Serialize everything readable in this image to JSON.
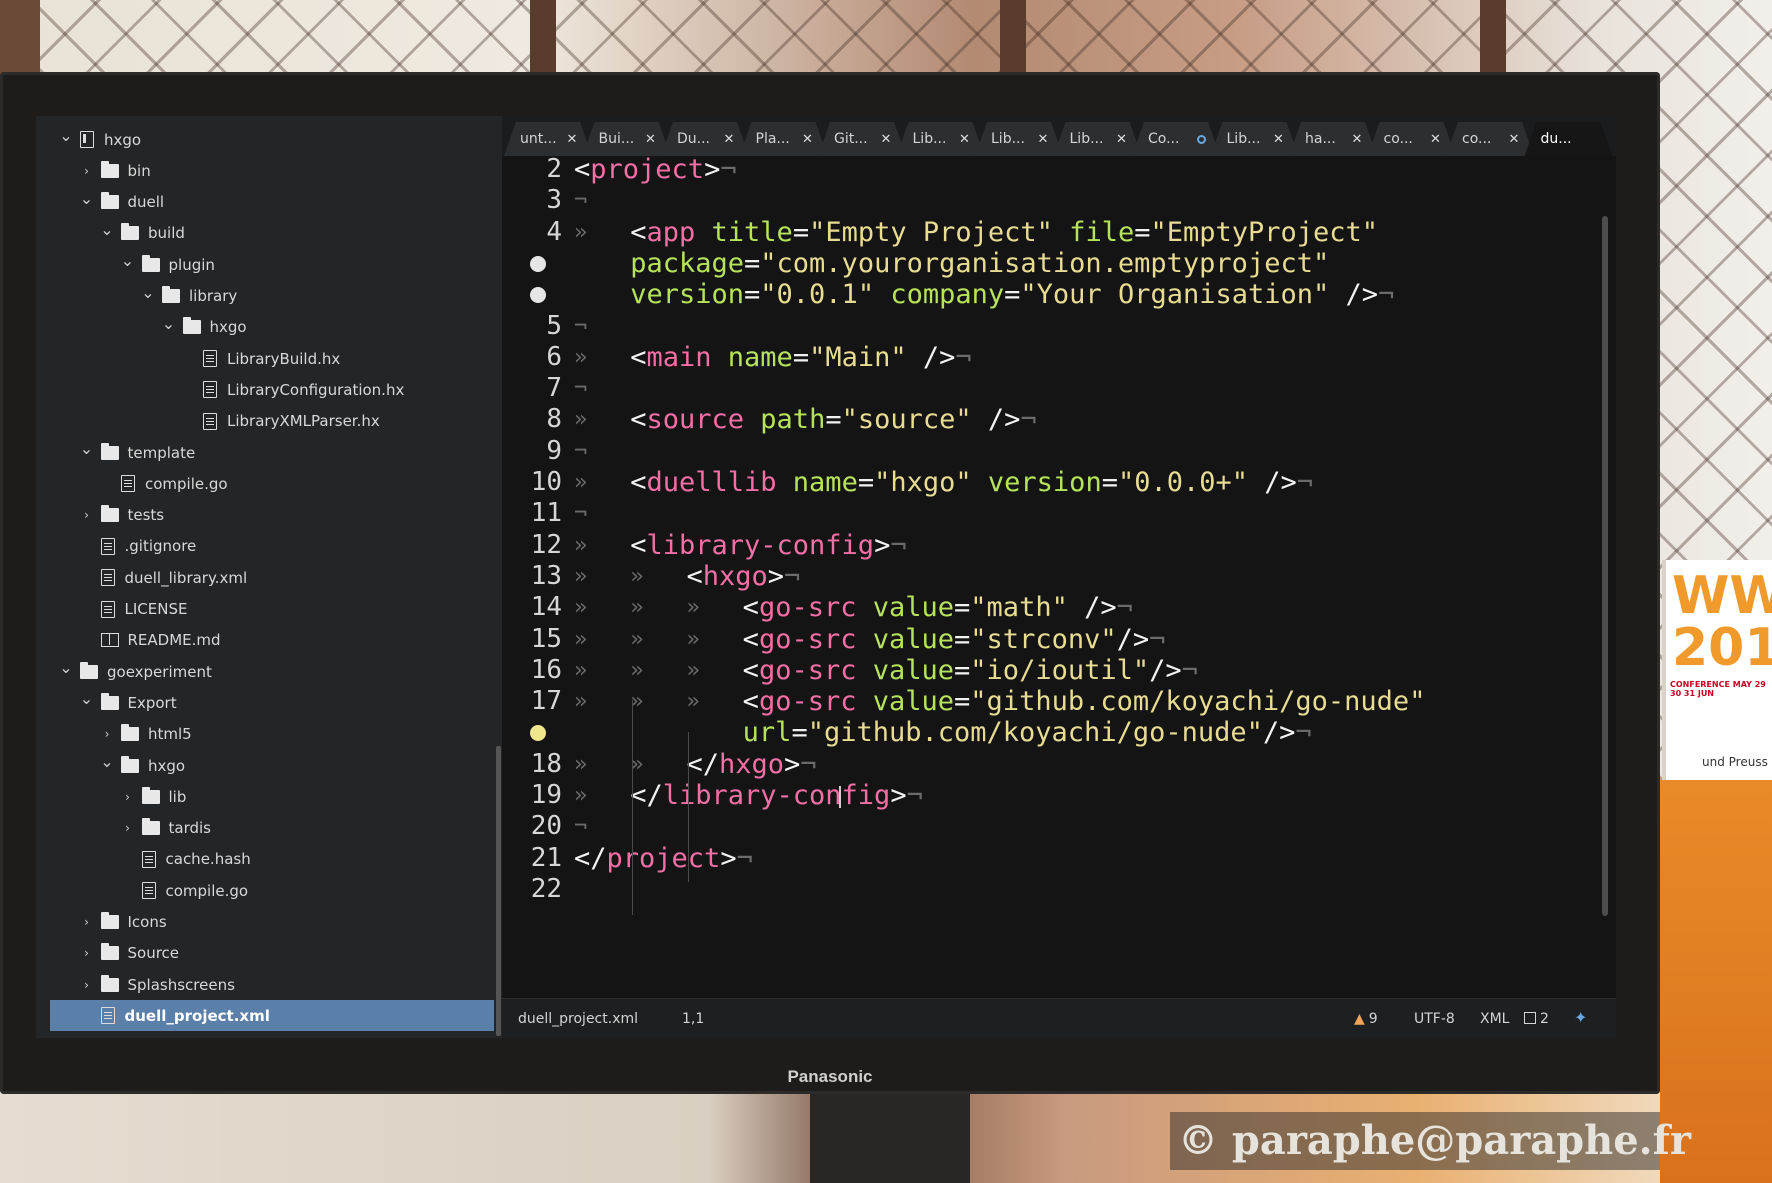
{
  "sidebar": {
    "tree": [
      {
        "label": "hxgo",
        "icon": "repo-icon",
        "chevron": "down",
        "depth": 0
      },
      {
        "label": "bin",
        "icon": "folder-icon",
        "chevron": "right",
        "depth": 1
      },
      {
        "label": "duell",
        "icon": "folder-icon",
        "chevron": "down",
        "depth": 1
      },
      {
        "label": "build",
        "icon": "folder-icon",
        "chevron": "down",
        "depth": 2
      },
      {
        "label": "plugin",
        "icon": "folder-icon",
        "chevron": "down",
        "depth": 3
      },
      {
        "label": "library",
        "icon": "folder-icon",
        "chevron": "down",
        "depth": 4
      },
      {
        "label": "hxgo",
        "icon": "folder-icon",
        "chevron": "down",
        "depth": 5
      },
      {
        "label": "LibraryBuild.hx",
        "icon": "file-icon",
        "chevron": "none",
        "depth": 6
      },
      {
        "label": "LibraryConfiguration.hx",
        "icon": "file-icon",
        "chevron": "none",
        "depth": 6
      },
      {
        "label": "LibraryXMLParser.hx",
        "icon": "file-icon",
        "chevron": "none",
        "depth": 6
      },
      {
        "label": "template",
        "icon": "folder-icon",
        "chevron": "down",
        "depth": 1
      },
      {
        "label": "compile.go",
        "icon": "file-icon",
        "chevron": "none",
        "depth": 2
      },
      {
        "label": "tests",
        "icon": "folder-icon",
        "chevron": "right",
        "depth": 1
      },
      {
        "label": ".gitignore",
        "icon": "file-icon",
        "chevron": "none",
        "depth": 1
      },
      {
        "label": "duell_library.xml",
        "icon": "file-icon",
        "chevron": "none",
        "depth": 1
      },
      {
        "label": "LICENSE",
        "icon": "file-icon",
        "chevron": "none",
        "depth": 1
      },
      {
        "label": "README.md",
        "icon": "book-icon",
        "chevron": "none",
        "depth": 1
      },
      {
        "label": "goexperiment",
        "icon": "folder-icon",
        "chevron": "down",
        "depth": 0
      },
      {
        "label": "Export",
        "icon": "folder-icon",
        "chevron": "down",
        "depth": 1
      },
      {
        "label": "html5",
        "icon": "folder-icon",
        "chevron": "right",
        "depth": 2
      },
      {
        "label": "hxgo",
        "icon": "folder-icon",
        "chevron": "down",
        "depth": 2
      },
      {
        "label": "lib",
        "icon": "folder-icon",
        "chevron": "right",
        "depth": 3
      },
      {
        "label": "tardis",
        "icon": "folder-icon",
        "chevron": "right",
        "depth": 3
      },
      {
        "label": "cache.hash",
        "icon": "file-icon",
        "chevron": "none",
        "depth": 3
      },
      {
        "label": "compile.go",
        "icon": "file-icon",
        "chevron": "none",
        "depth": 3
      },
      {
        "label": "Icons",
        "icon": "folder-icon",
        "chevron": "right",
        "depth": 1
      },
      {
        "label": "Source",
        "icon": "folder-icon",
        "chevron": "right",
        "depth": 1
      },
      {
        "label": "Splashscreens",
        "icon": "folder-icon",
        "chevron": "right",
        "depth": 1
      },
      {
        "label": "duell_project.xml",
        "icon": "file-icon",
        "chevron": "none",
        "depth": 1,
        "selected": true
      }
    ]
  },
  "tabs": [
    {
      "label": "unt...",
      "modified": false
    },
    {
      "label": "Bui...",
      "modified": false
    },
    {
      "label": "Du...",
      "modified": false
    },
    {
      "label": "Pla...",
      "modified": false
    },
    {
      "label": "Git...",
      "modified": false
    },
    {
      "label": "Lib...",
      "modified": false
    },
    {
      "label": "Lib...",
      "modified": false
    },
    {
      "label": "Lib...",
      "modified": false
    },
    {
      "label": "Co...",
      "modified": true
    },
    {
      "label": "Lib...",
      "modified": false
    },
    {
      "label": "ha...",
      "modified": false
    },
    {
      "label": "co...",
      "modified": false
    },
    {
      "label": "co...",
      "modified": false
    },
    {
      "label": "du...",
      "modified": false,
      "active": true
    }
  ],
  "editor": {
    "gutter": [
      {
        "n": "2"
      },
      {
        "n": "3"
      },
      {
        "n": "4"
      },
      {
        "dot": "white"
      },
      {
        "dot": "white"
      },
      {
        "n": "5"
      },
      {
        "n": "6"
      },
      {
        "n": "7"
      },
      {
        "n": "8"
      },
      {
        "n": "9"
      },
      {
        "n": "10"
      },
      {
        "n": "11"
      },
      {
        "n": "12"
      },
      {
        "n": "13"
      },
      {
        "n": "14"
      },
      {
        "n": "15"
      },
      {
        "n": "16"
      },
      {
        "n": "17"
      },
      {
        "dot": "yellow"
      },
      {
        "n": "18"
      },
      {
        "n": "19"
      },
      {
        "n": "20"
      },
      {
        "n": "21"
      },
      {
        "n": "22"
      }
    ],
    "lines": [
      {
        "indent": 0,
        "marks": 0,
        "tokens": [
          [
            "punc",
            "<"
          ],
          [
            "tag",
            "project"
          ],
          [
            "punc",
            ">"
          ],
          [
            "eol",
            "¬"
          ]
        ]
      },
      {
        "indent": 0,
        "marks": 0,
        "tokens": [
          [
            "eol",
            "¬"
          ]
        ]
      },
      {
        "indent": 2,
        "marks": 1,
        "tokens": [
          [
            "punc",
            "<"
          ],
          [
            "tag",
            "app"
          ],
          [
            "punc",
            " "
          ],
          [
            "attr",
            "title"
          ],
          [
            "punc",
            "="
          ],
          [
            "str",
            "\"Empty Project\""
          ],
          [
            "punc",
            " "
          ],
          [
            "attr",
            "file"
          ],
          [
            "punc",
            "="
          ],
          [
            "str",
            "\"EmptyProject\""
          ]
        ]
      },
      {
        "indent": 2,
        "marks": 0,
        "tokens": [
          [
            "attr",
            "package"
          ],
          [
            "punc",
            "="
          ],
          [
            "str",
            "\"com.yourorganisation.emptyproject\""
          ]
        ]
      },
      {
        "indent": 2,
        "marks": 0,
        "tokens": [
          [
            "attr",
            "version"
          ],
          [
            "punc",
            "="
          ],
          [
            "str",
            "\"0.0.1\""
          ],
          [
            "punc",
            " "
          ],
          [
            "attr",
            "company"
          ],
          [
            "punc",
            "="
          ],
          [
            "str",
            "\"Your Organisation\""
          ],
          [
            "punc",
            " />"
          ],
          [
            "eol",
            "¬"
          ]
        ]
      },
      {
        "indent": 0,
        "marks": 0,
        "tokens": [
          [
            "eol",
            "¬"
          ]
        ]
      },
      {
        "indent": 2,
        "marks": 1,
        "tokens": [
          [
            "punc",
            "<"
          ],
          [
            "tag",
            "main"
          ],
          [
            "punc",
            " "
          ],
          [
            "attr",
            "name"
          ],
          [
            "punc",
            "="
          ],
          [
            "str",
            "\"Main\""
          ],
          [
            "punc",
            " />"
          ],
          [
            "eol",
            "¬"
          ]
        ]
      },
      {
        "indent": 0,
        "marks": 0,
        "tokens": [
          [
            "eol",
            "¬"
          ]
        ]
      },
      {
        "indent": 2,
        "marks": 1,
        "tokens": [
          [
            "punc",
            "<"
          ],
          [
            "tag",
            "source"
          ],
          [
            "punc",
            " "
          ],
          [
            "attr",
            "path"
          ],
          [
            "punc",
            "="
          ],
          [
            "str",
            "\"source\""
          ],
          [
            "punc",
            " />"
          ],
          [
            "eol",
            "¬"
          ]
        ]
      },
      {
        "indent": 0,
        "marks": 0,
        "tokens": [
          [
            "eol",
            "¬"
          ]
        ]
      },
      {
        "indent": 2,
        "marks": 1,
        "tokens": [
          [
            "punc",
            "<"
          ],
          [
            "tag",
            "duelllib"
          ],
          [
            "punc",
            " "
          ],
          [
            "attr",
            "name"
          ],
          [
            "punc",
            "="
          ],
          [
            "str",
            "\"hxgo\""
          ],
          [
            "punc",
            " "
          ],
          [
            "attr",
            "version"
          ],
          [
            "punc",
            "="
          ],
          [
            "str",
            "\"0.0.0+\""
          ],
          [
            "punc",
            " />"
          ],
          [
            "eol",
            "¬"
          ]
        ]
      },
      {
        "indent": 0,
        "marks": 0,
        "tokens": [
          [
            "eol",
            "¬"
          ]
        ]
      },
      {
        "indent": 2,
        "marks": 1,
        "tokens": [
          [
            "punc",
            "<"
          ],
          [
            "tag",
            "library-config"
          ],
          [
            "punc",
            ">"
          ],
          [
            "eol",
            "¬"
          ]
        ]
      },
      {
        "indent": 4,
        "marks": 2,
        "tokens": [
          [
            "punc",
            "<"
          ],
          [
            "tag",
            "hxgo"
          ],
          [
            "punc",
            ">"
          ],
          [
            "eol",
            "¬"
          ]
        ]
      },
      {
        "indent": 6,
        "marks": 3,
        "tokens": [
          [
            "punc",
            "<"
          ],
          [
            "tag",
            "go-src"
          ],
          [
            "punc",
            " "
          ],
          [
            "attr",
            "value"
          ],
          [
            "punc",
            "="
          ],
          [
            "str",
            "\"math\""
          ],
          [
            "punc",
            " />"
          ],
          [
            "eol",
            "¬"
          ]
        ]
      },
      {
        "indent": 6,
        "marks": 3,
        "tokens": [
          [
            "punc",
            "<"
          ],
          [
            "tag",
            "go-src"
          ],
          [
            "punc",
            " "
          ],
          [
            "attr",
            "value"
          ],
          [
            "punc",
            "="
          ],
          [
            "str",
            "\"strconv\""
          ],
          [
            "punc",
            "/>"
          ],
          [
            "eol",
            "¬"
          ]
        ]
      },
      {
        "indent": 6,
        "marks": 3,
        "tokens": [
          [
            "punc",
            "<"
          ],
          [
            "tag",
            "go-src"
          ],
          [
            "punc",
            " "
          ],
          [
            "attr",
            "value"
          ],
          [
            "punc",
            "="
          ],
          [
            "str",
            "\"io/ioutil\""
          ],
          [
            "punc",
            "/>"
          ],
          [
            "eol",
            "¬"
          ]
        ]
      },
      {
        "indent": 6,
        "marks": 3,
        "tokens": [
          [
            "punc",
            "<"
          ],
          [
            "tag",
            "go-src"
          ],
          [
            "punc",
            " "
          ],
          [
            "attr",
            "value"
          ],
          [
            "punc",
            "="
          ],
          [
            "str",
            "\"github.com/koyachi/go-nude\""
          ]
        ]
      },
      {
        "indent": 6,
        "marks": 0,
        "tokens": [
          [
            "attr",
            "url"
          ],
          [
            "punc",
            "="
          ],
          [
            "str",
            "\"github.com/koyachi/go-nude\""
          ],
          [
            "punc",
            "/>"
          ],
          [
            "eol",
            "¬"
          ]
        ]
      },
      {
        "indent": 4,
        "marks": 2,
        "tokens": [
          [
            "punc",
            "</"
          ],
          [
            "tag",
            "hxgo"
          ],
          [
            "punc",
            ">"
          ],
          [
            "eol",
            "¬"
          ]
        ]
      },
      {
        "indent": 2,
        "marks": 1,
        "tokens": [
          [
            "punc",
            "</"
          ],
          [
            "tag",
            "library-config"
          ],
          [
            "punc",
            ">"
          ],
          [
            "eol",
            "¬"
          ]
        ]
      },
      {
        "indent": 0,
        "marks": 0,
        "tokens": [
          [
            "eol",
            "¬"
          ]
        ]
      },
      {
        "indent": 0,
        "marks": 0,
        "tokens": [
          [
            "punc",
            "</"
          ],
          [
            "tag",
            "project"
          ],
          [
            "punc",
            ">"
          ],
          [
            "eol",
            "¬"
          ]
        ]
      },
      {
        "indent": 0,
        "marks": 0,
        "tokens": []
      }
    ]
  },
  "statusbar": {
    "file_name": "duell_project.xml",
    "cursor_position": "1,1",
    "warnings_count": "9",
    "encoding": "UTF-8",
    "grammar": "XML",
    "packages_count": "2"
  },
  "monitor": {
    "brand": "Panasonic"
  },
  "background": {
    "banner_text": "WW\n201",
    "banner_small": "CONFERENCE MAY 29 30 31 JUN",
    "banner_name": "und Preuss"
  },
  "watermark": "© paraphe@paraphe.fr",
  "colors": {
    "tag": "#f26fa5",
    "attr": "#b6e35b",
    "string": "#e7dc92",
    "selected_row": "#5a7fa8",
    "warning": "#f0a35a"
  }
}
